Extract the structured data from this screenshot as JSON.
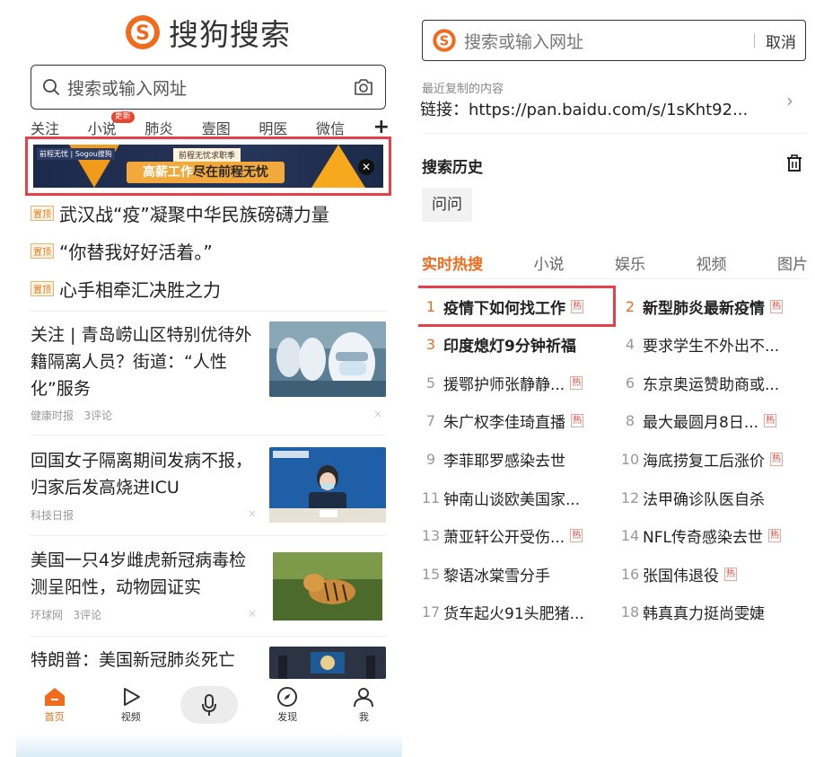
{
  "left": {
    "logo_text": "搜狗搜索",
    "search_placeholder": "搜索或输入网址",
    "channels": [
      {
        "label": "关注"
      },
      {
        "label": "小说",
        "badge": "更新"
      },
      {
        "label": "肺炎"
      },
      {
        "label": "壹图"
      },
      {
        "label": "明医"
      },
      {
        "label": "微信"
      }
    ],
    "add_channel": "+",
    "ad": {
      "brand": "前程无忧 | Sogou搜狗",
      "subtitle": "前程无忧求职季",
      "headline_a": "高薪工作",
      "headline_b": "尽在前程无忧",
      "close": "✕"
    },
    "pinned": [
      {
        "tag": "置顶",
        "title": "武汉战“疫”凝聚中华民族磅礴力量"
      },
      {
        "tag": "置顶",
        "title": "“你替我好好活着。”"
      },
      {
        "tag": "置顶",
        "title": "心手相牵汇决胜之力"
      }
    ],
    "news": [
      {
        "title": "关注 | 青岛崂山区特别优待外籍隔离人员？街道：“人性化”服务",
        "source": "健康时报",
        "comments": "3评论",
        "close": "×"
      },
      {
        "title": "回国女子隔离期间发病不报，归家后发高烧进ICU",
        "source": "科技日报",
        "comments": "",
        "close": "×"
      },
      {
        "title": "美国一只4岁雌虎新冠病毒检测呈阳性，动物园证实",
        "source": "环球网",
        "comments": "3评论",
        "close": "×"
      },
      {
        "title": "特朗普：美国新冠肺炎死亡",
        "source": "",
        "comments": "",
        "close": ""
      }
    ],
    "tabbar": [
      {
        "label": "首页"
      },
      {
        "label": "视频"
      },
      {
        "label": "发现"
      },
      {
        "label": "我"
      }
    ]
  },
  "right": {
    "search_placeholder": "搜索或输入网址",
    "cancel": "取消",
    "copied_label": "最近复制的内容",
    "copied_link": "链接：https://pan.baidu.com/s/1sKht92...",
    "history_title": "搜索历史",
    "history_chips": [
      "问问"
    ],
    "hot_tabs": [
      "实时热搜",
      "小说",
      "娱乐",
      "视频",
      "图片"
    ],
    "hot_badge": "热",
    "hot_list": [
      {
        "rank": "1",
        "text": "疫情下如何找工作",
        "hot": true,
        "bold": true
      },
      {
        "rank": "2",
        "text": "新型肺炎最新疫情",
        "hot": true,
        "bold": true
      },
      {
        "rank": "3",
        "text": "印度熄灯9分钟祈福",
        "hot": false,
        "bold": true
      },
      {
        "rank": "4",
        "text": "要求学生不外出不...",
        "hot": false,
        "bold": false
      },
      {
        "rank": "5",
        "text": "援鄂护师张静静...",
        "hot": true,
        "bold": false
      },
      {
        "rank": "6",
        "text": "东京奥运赞助商或...",
        "hot": false,
        "bold": false
      },
      {
        "rank": "7",
        "text": "朱广权李佳琦直播",
        "hot": true,
        "bold": false
      },
      {
        "rank": "8",
        "text": "最大最圆月8日...",
        "hot": true,
        "bold": false
      },
      {
        "rank": "9",
        "text": "李菲耶罗感染去世",
        "hot": false,
        "bold": false
      },
      {
        "rank": "10",
        "text": "海底捞复工后涨价",
        "hot": true,
        "bold": false
      },
      {
        "rank": "11",
        "text": "钟南山谈欧美国家...",
        "hot": false,
        "bold": false
      },
      {
        "rank": "12",
        "text": "法甲确诊队医自杀",
        "hot": false,
        "bold": false
      },
      {
        "rank": "13",
        "text": "萧亚轩公开受伤...",
        "hot": true,
        "bold": false
      },
      {
        "rank": "14",
        "text": "NFL传奇感染去世",
        "hot": true,
        "bold": false
      },
      {
        "rank": "15",
        "text": "黎语冰棠雪分手",
        "hot": false,
        "bold": false
      },
      {
        "rank": "16",
        "text": "张国伟退役",
        "hot": true,
        "bold": false
      },
      {
        "rank": "17",
        "text": "货车起火91头肥猪...",
        "hot": false,
        "bold": false
      },
      {
        "rank": "18",
        "text": "韩真真力挺尚雯婕",
        "hot": false,
        "bold": false
      }
    ]
  }
}
